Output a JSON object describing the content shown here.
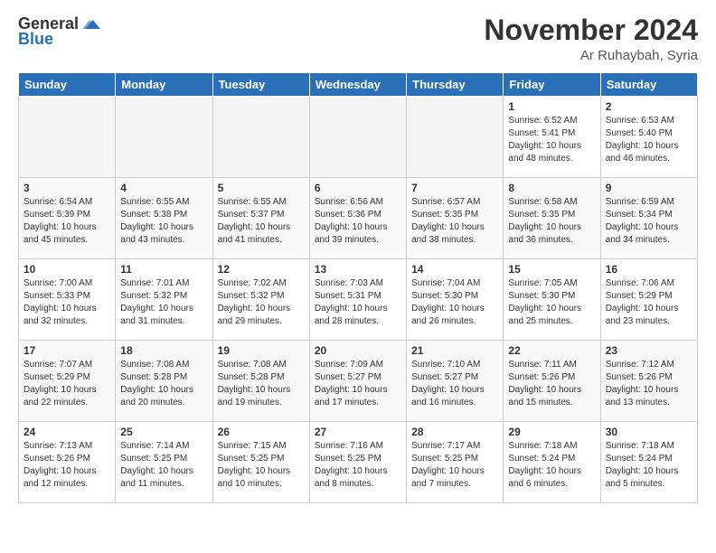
{
  "logo": {
    "general": "General",
    "blue": "Blue"
  },
  "header": {
    "month": "November 2024",
    "location": "Ar Ruhaybah, Syria"
  },
  "weekdays": [
    "Sunday",
    "Monday",
    "Tuesday",
    "Wednesday",
    "Thursday",
    "Friday",
    "Saturday"
  ],
  "weeks": [
    [
      {
        "day": "",
        "sunrise": "",
        "sunset": "",
        "daylight": ""
      },
      {
        "day": "",
        "sunrise": "",
        "sunset": "",
        "daylight": ""
      },
      {
        "day": "",
        "sunrise": "",
        "sunset": "",
        "daylight": ""
      },
      {
        "day": "",
        "sunrise": "",
        "sunset": "",
        "daylight": ""
      },
      {
        "day": "",
        "sunrise": "",
        "sunset": "",
        "daylight": ""
      },
      {
        "day": "1",
        "sunrise": "Sunrise: 6:52 AM",
        "sunset": "Sunset: 5:41 PM",
        "daylight": "Daylight: 10 hours and 48 minutes."
      },
      {
        "day": "2",
        "sunrise": "Sunrise: 6:53 AM",
        "sunset": "Sunset: 5:40 PM",
        "daylight": "Daylight: 10 hours and 46 minutes."
      }
    ],
    [
      {
        "day": "3",
        "sunrise": "Sunrise: 6:54 AM",
        "sunset": "Sunset: 5:39 PM",
        "daylight": "Daylight: 10 hours and 45 minutes."
      },
      {
        "day": "4",
        "sunrise": "Sunrise: 6:55 AM",
        "sunset": "Sunset: 5:38 PM",
        "daylight": "Daylight: 10 hours and 43 minutes."
      },
      {
        "day": "5",
        "sunrise": "Sunrise: 6:55 AM",
        "sunset": "Sunset: 5:37 PM",
        "daylight": "Daylight: 10 hours and 41 minutes."
      },
      {
        "day": "6",
        "sunrise": "Sunrise: 6:56 AM",
        "sunset": "Sunset: 5:36 PM",
        "daylight": "Daylight: 10 hours and 39 minutes."
      },
      {
        "day": "7",
        "sunrise": "Sunrise: 6:57 AM",
        "sunset": "Sunset: 5:35 PM",
        "daylight": "Daylight: 10 hours and 38 minutes."
      },
      {
        "day": "8",
        "sunrise": "Sunrise: 6:58 AM",
        "sunset": "Sunset: 5:35 PM",
        "daylight": "Daylight: 10 hours and 36 minutes."
      },
      {
        "day": "9",
        "sunrise": "Sunrise: 6:59 AM",
        "sunset": "Sunset: 5:34 PM",
        "daylight": "Daylight: 10 hours and 34 minutes."
      }
    ],
    [
      {
        "day": "10",
        "sunrise": "Sunrise: 7:00 AM",
        "sunset": "Sunset: 5:33 PM",
        "daylight": "Daylight: 10 hours and 32 minutes."
      },
      {
        "day": "11",
        "sunrise": "Sunrise: 7:01 AM",
        "sunset": "Sunset: 5:32 PM",
        "daylight": "Daylight: 10 hours and 31 minutes."
      },
      {
        "day": "12",
        "sunrise": "Sunrise: 7:02 AM",
        "sunset": "Sunset: 5:32 PM",
        "daylight": "Daylight: 10 hours and 29 minutes."
      },
      {
        "day": "13",
        "sunrise": "Sunrise: 7:03 AM",
        "sunset": "Sunset: 5:31 PM",
        "daylight": "Daylight: 10 hours and 28 minutes."
      },
      {
        "day": "14",
        "sunrise": "Sunrise: 7:04 AM",
        "sunset": "Sunset: 5:30 PM",
        "daylight": "Daylight: 10 hours and 26 minutes."
      },
      {
        "day": "15",
        "sunrise": "Sunrise: 7:05 AM",
        "sunset": "Sunset: 5:30 PM",
        "daylight": "Daylight: 10 hours and 25 minutes."
      },
      {
        "day": "16",
        "sunrise": "Sunrise: 7:06 AM",
        "sunset": "Sunset: 5:29 PM",
        "daylight": "Daylight: 10 hours and 23 minutes."
      }
    ],
    [
      {
        "day": "17",
        "sunrise": "Sunrise: 7:07 AM",
        "sunset": "Sunset: 5:29 PM",
        "daylight": "Daylight: 10 hours and 22 minutes."
      },
      {
        "day": "18",
        "sunrise": "Sunrise: 7:08 AM",
        "sunset": "Sunset: 5:28 PM",
        "daylight": "Daylight: 10 hours and 20 minutes."
      },
      {
        "day": "19",
        "sunrise": "Sunrise: 7:08 AM",
        "sunset": "Sunset: 5:28 PM",
        "daylight": "Daylight: 10 hours and 19 minutes."
      },
      {
        "day": "20",
        "sunrise": "Sunrise: 7:09 AM",
        "sunset": "Sunset: 5:27 PM",
        "daylight": "Daylight: 10 hours and 17 minutes."
      },
      {
        "day": "21",
        "sunrise": "Sunrise: 7:10 AM",
        "sunset": "Sunset: 5:27 PM",
        "daylight": "Daylight: 10 hours and 16 minutes."
      },
      {
        "day": "22",
        "sunrise": "Sunrise: 7:11 AM",
        "sunset": "Sunset: 5:26 PM",
        "daylight": "Daylight: 10 hours and 15 minutes."
      },
      {
        "day": "23",
        "sunrise": "Sunrise: 7:12 AM",
        "sunset": "Sunset: 5:26 PM",
        "daylight": "Daylight: 10 hours and 13 minutes."
      }
    ],
    [
      {
        "day": "24",
        "sunrise": "Sunrise: 7:13 AM",
        "sunset": "Sunset: 5:26 PM",
        "daylight": "Daylight: 10 hours and 12 minutes."
      },
      {
        "day": "25",
        "sunrise": "Sunrise: 7:14 AM",
        "sunset": "Sunset: 5:25 PM",
        "daylight": "Daylight: 10 hours and 11 minutes."
      },
      {
        "day": "26",
        "sunrise": "Sunrise: 7:15 AM",
        "sunset": "Sunset: 5:25 PM",
        "daylight": "Daylight: 10 hours and 10 minutes."
      },
      {
        "day": "27",
        "sunrise": "Sunrise: 7:16 AM",
        "sunset": "Sunset: 5:25 PM",
        "daylight": "Daylight: 10 hours and 8 minutes."
      },
      {
        "day": "28",
        "sunrise": "Sunrise: 7:17 AM",
        "sunset": "Sunset: 5:25 PM",
        "daylight": "Daylight: 10 hours and 7 minutes."
      },
      {
        "day": "29",
        "sunrise": "Sunrise: 7:18 AM",
        "sunset": "Sunset: 5:24 PM",
        "daylight": "Daylight: 10 hours and 6 minutes."
      },
      {
        "day": "30",
        "sunrise": "Sunrise: 7:18 AM",
        "sunset": "Sunset: 5:24 PM",
        "daylight": "Daylight: 10 hours and 5 minutes."
      }
    ]
  ]
}
